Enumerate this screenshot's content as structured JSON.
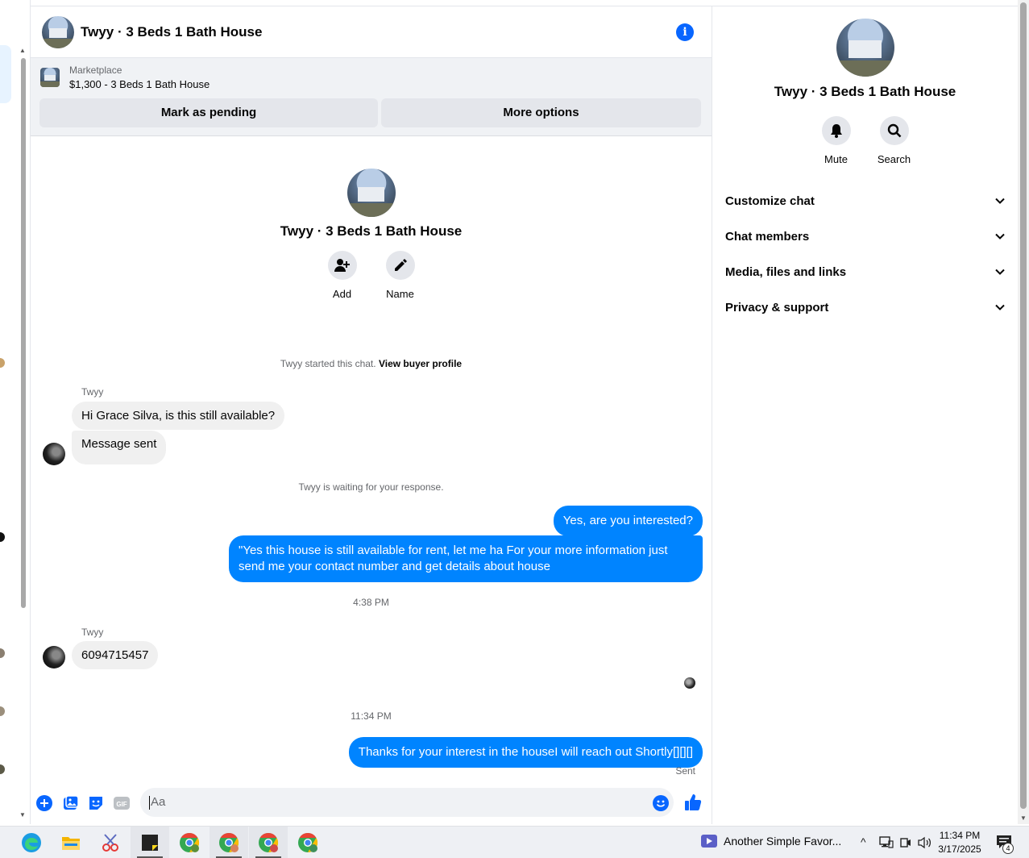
{
  "chat": {
    "title": "Twyy · 3 Beds 1 Bath House",
    "marketplace_label": "Marketplace",
    "listing": "$1,300 - 3 Beds 1 Bath House",
    "mark_pending": "Mark as pending",
    "more_options": "More options",
    "center_name": "Twyy · 3 Beds 1 Bath House",
    "add_label": "Add",
    "name_label": "Name",
    "started_text": "Twyy started this chat.",
    "view_profile": "View buyer profile",
    "messages": {
      "sender1": "Twyy",
      "m1": "Hi Grace Silva, is this still available?",
      "m2": "Message sent",
      "waiting": "Twyy is waiting for your response.",
      "m3": "Yes, are you interested?",
      "m4": "\"Yes this house is still available for rent, let me ha For  your  more  information  just  send  me   your  contact  number  and get details about house",
      "time1": "4:38 PM",
      "sender2": "Twyy",
      "m5": "6094715457",
      "time2": "11:34 PM",
      "m6": "Thanks for your interest in the houseI will reach out Shortly[][][]",
      "status": "Sent"
    },
    "composer_placeholder": "Aa"
  },
  "right_panel": {
    "name": "Twyy · 3 Beds 1 Bath House",
    "mute": "Mute",
    "search": "Search",
    "sections": [
      "Customize chat",
      "Chat members",
      "Media, files and links",
      "Privacy & support"
    ]
  },
  "taskbar": {
    "media_title": "Another Simple Favor...",
    "time": "11:34 PM",
    "date": "3/17/2025",
    "notifications": "4"
  },
  "colors": {
    "accent": "#0866ff",
    "outgoing_bubble": "#0084ff",
    "incoming_bubble": "#f0f0f0"
  }
}
